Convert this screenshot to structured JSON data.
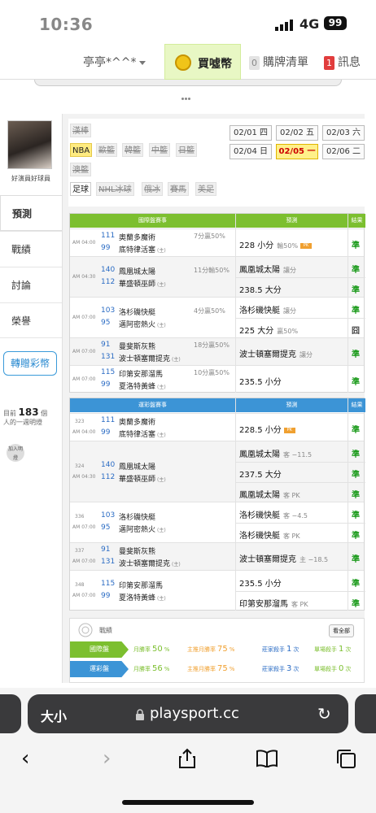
{
  "status": {
    "time": "10:36",
    "network": "4G",
    "battery": "99"
  },
  "topnav": {
    "user": "亭亭*^^*",
    "buy_label": "買噓幣",
    "cart_count": "0",
    "cart_label": "購牌清單",
    "msg_count": "1",
    "msg_label": "訊息"
  },
  "profile": {
    "name": "好演員好球員"
  },
  "leftnav": {
    "items": [
      "預測",
      "戰績",
      "討論",
      "榮譽"
    ],
    "transfer": "轉贈彩幣",
    "online_prefix": "目前",
    "online_count": "183",
    "online_suffix": "個",
    "online_line2": "人的一週明燈",
    "add_label": "加入明燈"
  },
  "sports": {
    "row1": [
      "漢棒"
    ],
    "row2": [
      "NBA",
      "歐籃",
      "韓籃",
      "中籃",
      "日籃"
    ],
    "row3": [
      "澳籃"
    ],
    "row4": [
      "足球",
      "NHL冰球",
      "俄冰",
      "賽馬",
      "美足"
    ],
    "dates": [
      "02/01 四",
      "02/02 五",
      "02/03 六",
      "02/04 日",
      "02/05 一",
      "02/06 二"
    ]
  },
  "intl_table": {
    "title": "國際盤賽事",
    "pred": "預測",
    "result": "結果",
    "games": [
      {
        "time": "AM 04:00",
        "n1": "111",
        "t1": "奧蘭多魔術",
        "n2": "99",
        "t2": "底特律活塞",
        "home": "(主)",
        "rate": "7分贏50%",
        "picks": [
          {
            "text": "228 小分",
            "note": "輸50%",
            "hot": "PK",
            "result": "準"
          }
        ]
      },
      {
        "time": "AM 04:30",
        "n1": "140",
        "t1": "鳳凰城太陽",
        "n2": "112",
        "t2": "華盛頓巫師",
        "home": "(主)",
        "rate": "11分輸50%",
        "picks": [
          {
            "text": "鳳凰城太陽",
            "note": "讓分",
            "result": "準"
          },
          {
            "text": "238.5 大分",
            "note": "",
            "result": "準"
          }
        ]
      },
      {
        "time": "AM 07:00",
        "n1": "103",
        "t1": "洛杉磯快艇",
        "n2": "95",
        "t2": "邁阿密熱火",
        "home": "(主)",
        "rate": "4分贏50%",
        "picks": [
          {
            "text": "洛杉磯快艇",
            "note": "讓分",
            "result": "準"
          },
          {
            "text": "225 大分",
            "note": "贏50%",
            "result": "囧"
          }
        ]
      },
      {
        "time": "AM 07:00",
        "n1": "91",
        "t1": "曼斐斯灰熊",
        "n2": "131",
        "t2": "波士頓塞爾提克",
        "home": "(主)",
        "rate": "18分贏50%",
        "picks": [
          {
            "text": "波士頓塞爾提克",
            "note": "讓分",
            "result": "準"
          }
        ]
      },
      {
        "time": "AM 07:00",
        "n1": "115",
        "t1": "印第安那溜馬",
        "n2": "99",
        "t2": "夏洛特黃蜂",
        "home": "(主)",
        "rate": "10分贏50%",
        "picks": [
          {
            "text": "235.5 小分",
            "note": "",
            "result": "準"
          }
        ]
      }
    ]
  },
  "tw_table": {
    "title": "運彩盤賽事",
    "pred": "預測",
    "result": "結果",
    "games": [
      {
        "code": "323",
        "time": "AM 04:00",
        "n1": "111",
        "t1": "奧蘭多魔術",
        "n2": "99",
        "t2": "底特律活塞",
        "home": "(主)",
        "picks": [
          {
            "text": "228.5 小分",
            "note": "",
            "hot": "PK",
            "result": "準"
          }
        ]
      },
      {
        "code": "324",
        "time": "AM 04:30",
        "n1": "140",
        "t1": "鳳凰城太陽",
        "n2": "112",
        "t2": "華盛頓巫師",
        "home": "(主)",
        "picks": [
          {
            "text": "鳳凰城太陽",
            "note": "客 −11.5",
            "result": "準"
          },
          {
            "text": "237.5 大分",
            "note": "",
            "result": "準"
          },
          {
            "text": "鳳凰城太陽",
            "note": "客 PK",
            "result": "準"
          }
        ]
      },
      {
        "code": "336",
        "time": "AM 07:00",
        "n1": "103",
        "t1": "洛杉磯快艇",
        "n2": "95",
        "t2": "邁阿密熱火",
        "home": "(主)",
        "picks": [
          {
            "text": "洛杉磯快艇",
            "note": "客 −4.5",
            "result": "準"
          },
          {
            "text": "洛杉磯快艇",
            "note": "客 PK",
            "result": "準"
          }
        ]
      },
      {
        "code": "337",
        "time": "AM 07:00",
        "n1": "91",
        "t1": "曼斐斯灰熊",
        "n2": "131",
        "t2": "波士頓塞爾提克",
        "home": "(主)",
        "picks": [
          {
            "text": "波士頓塞爾提克",
            "note": "主 −18.5",
            "result": "準"
          }
        ]
      },
      {
        "code": "348",
        "time": "AM 07:00",
        "n1": "115",
        "t1": "印第安那溜馬",
        "n2": "99",
        "t2": "夏洛特黃蜂",
        "home": "(主)",
        "picks": [
          {
            "text": "235.5 小分",
            "note": "",
            "result": "準"
          },
          {
            "text": "印第安那溜馬",
            "note": "客 PK",
            "result": "準"
          }
        ]
      }
    ]
  },
  "stats": {
    "title": "戰績",
    "view_all": "看全部",
    "rows": [
      {
        "label": "國際盤",
        "month_label": "月勝率",
        "month": "50",
        "main_label": "主推月勝率",
        "main": "75",
        "bank_label": "莊家殺手",
        "bank": "1",
        "bank_unit": "次",
        "single_label": "單場殺手",
        "single": "1",
        "single_unit": "次"
      },
      {
        "label": "運彩盤",
        "month_label": "月勝率",
        "month": "56",
        "main_label": "主推月勝率",
        "main": "75",
        "bank_label": "莊家殺手",
        "bank": "3",
        "bank_unit": "次",
        "single_label": "單場殺手",
        "single": "0",
        "single_unit": "次"
      }
    ]
  },
  "browser": {
    "size": "大小",
    "url": "playsport.cc"
  }
}
